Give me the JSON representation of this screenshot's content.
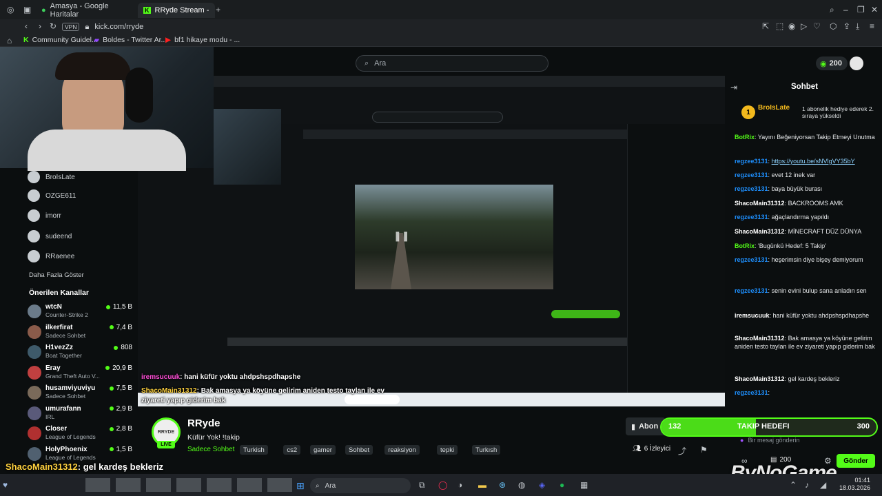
{
  "browser": {
    "tabs": [
      {
        "label": "Amasya - Google Haritalar",
        "active": false
      },
      {
        "label": "RRyde Stream - Watch Liv",
        "active": true
      }
    ],
    "url": "kick.com/rryde",
    "vpn": "VPN",
    "bookmarks": [
      "Community Guidel...",
      "Boldes - Twitter Ar...",
      "bf1 hikaye modu - ..."
    ]
  },
  "kick": {
    "search_placeholder": "Ara",
    "points": "200",
    "sidebar_followed": [
      {
        "name": "BroIsLate"
      },
      {
        "name": "OZGE611"
      },
      {
        "name": "imorr"
      },
      {
        "name": "sudeend"
      },
      {
        "name": "RRaenee"
      }
    ],
    "show_more": "Daha Fazla Göster",
    "recommended_title": "Önerilen Kanallar",
    "recommended": [
      {
        "name": "wtcN",
        "game": "Counter-Strike 2",
        "viewers": "11,5 B",
        "color": "#6b7b8a"
      },
      {
        "name": "ilkerfirat",
        "game": "Sadece Sohbet",
        "viewers": "7,4 B",
        "color": "#8a5b4a"
      },
      {
        "name": "H1vezZz",
        "game": "Boat Together",
        "viewers": "808",
        "color": "#3e5a6a"
      },
      {
        "name": "Eray",
        "game": "Grand Theft Auto V...",
        "viewers": "20,9 B",
        "color": "#c04040"
      },
      {
        "name": "husamviyuviyu",
        "game": "Sadece Sohbet",
        "viewers": "7,5 B",
        "color": "#7a6a5a"
      },
      {
        "name": "umurafann",
        "game": "IRL",
        "viewers": "2,9 B",
        "color": "#5a5a7a"
      },
      {
        "name": "Closer",
        "game": "League of Legends",
        "viewers": "2,8 B",
        "color": "#b03030"
      },
      {
        "name": "HolyPhoenix",
        "game": "League of Legends",
        "viewers": "1,5 B",
        "color": "#506070"
      }
    ],
    "channel": {
      "name": "RRyde",
      "logo_text": "RRYDE",
      "live": "LIVE",
      "title": "Küfür Yok! !takip",
      "category": "Sadece Sohbet",
      "tags": [
        "Turkish",
        "cs2",
        "gamer",
        "Sohbet",
        "reaksiyon",
        "tepki",
        "Turkısh"
      ],
      "subscribe": "Abon",
      "viewers": "6 İzleyici"
    },
    "chat": {
      "title": "Sohbet",
      "pinned_user": "BroIsLate",
      "pinned_note": "1 abonelik hediye ederek 2. sıraya yükseldi",
      "messages": [
        {
          "user": "BotRix",
          "cls": "u-green",
          "text": " Yayını Beğeniyorsan Takip Etmeyi Unutma"
        },
        {
          "user": "regzee3131",
          "cls": "u-blue",
          "text": "",
          "link": "https://youtu.be/sNVlgVY35bY"
        },
        {
          "user": "regzee3131",
          "cls": "u-blue",
          "text": " evet 12 inek var"
        },
        {
          "user": "regzee3131",
          "cls": "u-blue",
          "text": " baya büyük burası"
        },
        {
          "user": "ShacoMain31312",
          "cls": "u-white",
          "text": " BACKROOMS AMK"
        },
        {
          "user": "regzee3131",
          "cls": "u-blue",
          "text": " ağaçlandırma yapıldı"
        },
        {
          "user": "ShacoMain31312",
          "cls": "u-white",
          "text": " MİNECRAFT DÜZ DÜNYA"
        },
        {
          "user": "BotRix",
          "cls": "u-green",
          "text": " 'Bugünkü Hedef: 5 Takip'"
        },
        {
          "user": "regzee3131",
          "cls": "u-blue",
          "text": " heşerimsin diye bişey demiyorum"
        },
        {
          "user": "regzee3131",
          "cls": "u-blue",
          "text": " senin evini bulup sana anladın sen"
        },
        {
          "user": "iremsucuuk",
          "cls": "u-white",
          "text": " hani küfür yoktu ahdpshspdhapshe"
        },
        {
          "user": "ShacoMain31312",
          "cls": "u-white",
          "text": " Bak amasya ya köyüne gelirim aniden testo taylan ile ev ziyareti yapıp giderim bak"
        },
        {
          "user": "ShacoMain31312",
          "cls": "u-white",
          "text": " gel kardeş bekleriz"
        },
        {
          "user": "regzee3131",
          "cls": "u-blue",
          "text": ""
        }
      ],
      "goal_current": "132",
      "goal_label": "TAKIP HEDEFI",
      "goal_target": "300",
      "goal_fraction": 0.44,
      "input_placeholder": "Bir mesaj gönderin",
      "points": "200",
      "send": "Gönder"
    }
  },
  "overlay": {
    "chat_lines": [
      {
        "user": "iremsucuuk",
        "text": ": hani küfür yoktu ahdpshspdhapshe"
      },
      {
        "user": "ShacoMain31312",
        "text": ": Bak amasya ya köyüne gelirim aniden testo taylan ile ev ziyareti yapıp giderim bak"
      },
      {
        "user": "ShacoMain31312",
        "text": ": gel kardeş bekleriz"
      },
      {
        "user": "regzee3131",
        "text": ":"
      }
    ],
    "watermark": "ByNoGame"
  },
  "taskbar": {
    "search": "Ara",
    "time": "01:41",
    "date": "18.03.2026"
  }
}
